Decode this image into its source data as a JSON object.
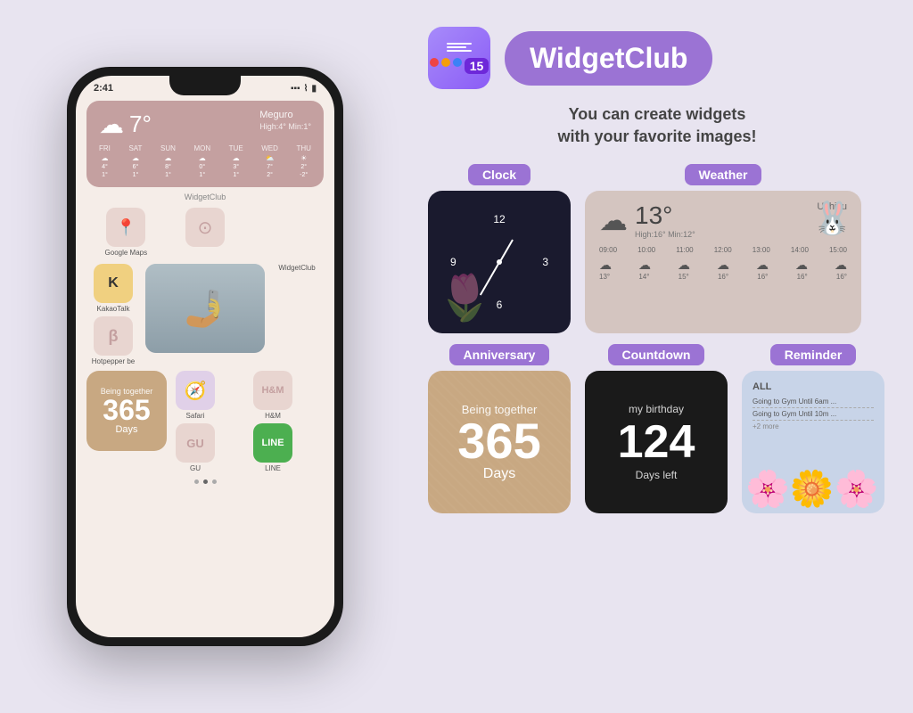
{
  "app": {
    "title": "WidgetClub",
    "tagline_line1": "You can create widgets",
    "tagline_line2": "with your favorite images!"
  },
  "phone": {
    "time": "2:41",
    "weather_widget": {
      "temp": "7°",
      "location": "Meguro",
      "high_low": "High:4° Min:1°",
      "days": [
        "FRI",
        "SAT",
        "SUN",
        "MON",
        "TUE",
        "WED",
        "THU"
      ],
      "day_temps": [
        "4°\n1°",
        "6°\n1°",
        "8°\n1°",
        "0°\n1°",
        "3°\n1°",
        "7°\n2°",
        "2°\n-2°"
      ]
    },
    "widgetclub_label": "WidgetClub",
    "apps_row1": [
      {
        "label": "Google Maps",
        "icon": "📍"
      },
      {
        "label": "",
        "icon": "⊙"
      },
      {
        "label": "",
        "icon": ""
      }
    ],
    "apps_row2": [
      {
        "label": "KakaoTalk",
        "icon": "💬"
      },
      {
        "label": "Hotpepper be",
        "icon": "β"
      },
      {
        "label": "WidgetClub",
        "icon": ""
      }
    ],
    "anniversary_widget": {
      "being_together": "Being together",
      "number": "365",
      "days": "Days"
    },
    "bottom_icons": [
      {
        "label": "Safari",
        "icon": "🧭"
      },
      {
        "label": "H&M",
        "icon": "H&M"
      },
      {
        "label": "GU",
        "icon": "GU"
      },
      {
        "label": "LINE",
        "icon": "LINE"
      }
    ]
  },
  "widgets": {
    "clock_label": "Clock",
    "weather_label": "Weather",
    "anniversary_label": "Anniversary",
    "countdown_label": "Countdown",
    "reminder_label": "Reminder",
    "weather_preview": {
      "temp": "13°",
      "location": "Ushiku",
      "high_low": "High:16° Min:12°",
      "times": [
        "09:00",
        "10:00",
        "11:00",
        "12:00",
        "13:00",
        "14:00",
        "15:00"
      ],
      "temps": [
        "13°",
        "14°",
        "15°",
        "16°",
        "16°",
        "16°",
        "16°"
      ]
    },
    "anniversary_preview": {
      "being_together": "Being together",
      "number": "365",
      "days": "Days"
    },
    "countdown_preview": {
      "title": "my birthday",
      "number": "124",
      "subtitle": "Days left"
    },
    "reminder_preview": {
      "header": "ALL",
      "items": [
        "Going to Gym Until 6am ...",
        "Going to Gym Until 10m ..."
      ],
      "more": "+2 more"
    }
  }
}
